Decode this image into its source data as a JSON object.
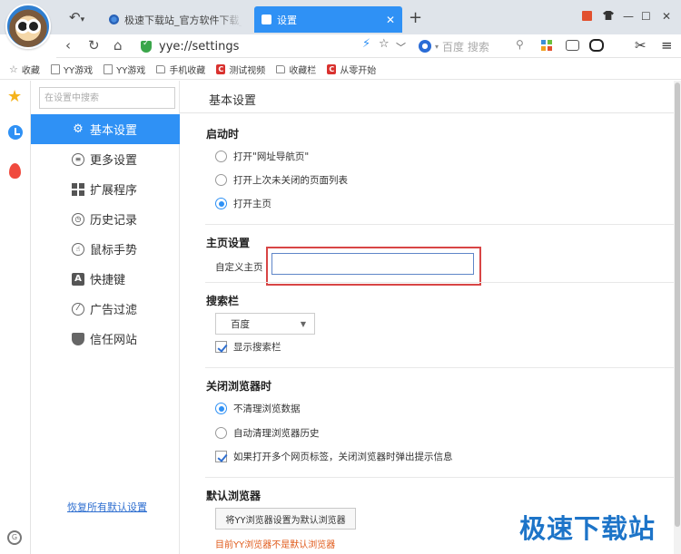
{
  "browser": {
    "undo_label": "↶",
    "tabs": [
      {
        "title": "极速下载站_官方软件下载_最",
        "active": false
      },
      {
        "title": "设置",
        "active": true
      }
    ],
    "address": "yye://settings",
    "search_placeholder": "百度 搜索",
    "window_controls": [
      "—",
      "☐",
      "✕"
    ]
  },
  "bookmarks": [
    {
      "label": "收藏",
      "icon": "star-icon"
    },
    {
      "label": "YY游戏",
      "icon": "page-icon"
    },
    {
      "label": "YY游戏",
      "icon": "page-icon"
    },
    {
      "label": "手机收藏",
      "icon": "folder-icon"
    },
    {
      "label": "测试视频",
      "icon": "red-c-icon"
    },
    {
      "label": "收藏栏",
      "icon": "folder-icon"
    },
    {
      "label": "从零开始",
      "icon": "red-c-icon"
    }
  ],
  "sidebar": {
    "search_placeholder": "在设置中搜索",
    "items": [
      {
        "label": "基本设置",
        "icon": "gear-icon",
        "active": true
      },
      {
        "label": "更多设置",
        "icon": "list-icon"
      },
      {
        "label": "扩展程序",
        "icon": "tiles-icon"
      },
      {
        "label": "历史记录",
        "icon": "clock-icon"
      },
      {
        "label": "鼠标手势",
        "icon": "gesture-icon"
      },
      {
        "label": "快捷键",
        "icon": "a-key-icon"
      },
      {
        "label": "广告过滤",
        "icon": "block-icon"
      },
      {
        "label": "信任网站",
        "icon": "shield-icon"
      }
    ],
    "restore_link": "恢复所有默认设置"
  },
  "settings": {
    "page_title": "基本设置",
    "startup": {
      "title": "启动时",
      "options": [
        "打开\"网址导航页\"",
        "打开上次未关闭的页面列表",
        "打开主页"
      ],
      "selected_index": 2
    },
    "homepage": {
      "title": "主页设置",
      "label": "自定义主页",
      "value": ""
    },
    "searchbar": {
      "title": "搜索栏",
      "engine": "百度",
      "show_label": "显示搜索栏",
      "show_checked": true
    },
    "on_close": {
      "title": "关闭浏览器时",
      "options": [
        "不清理浏览数据",
        "自动清理浏览器历史"
      ],
      "selected_index": 0,
      "warn_label": "如果打开多个网页标签，关闭浏览器时弹出提示信息",
      "warn_checked": true
    },
    "default_browser": {
      "title": "默认浏览器",
      "button": "将YY浏览器设置为默认浏览器",
      "status": "目前YY浏览器不是默认浏览器"
    }
  },
  "watermark": "极速下载站"
}
